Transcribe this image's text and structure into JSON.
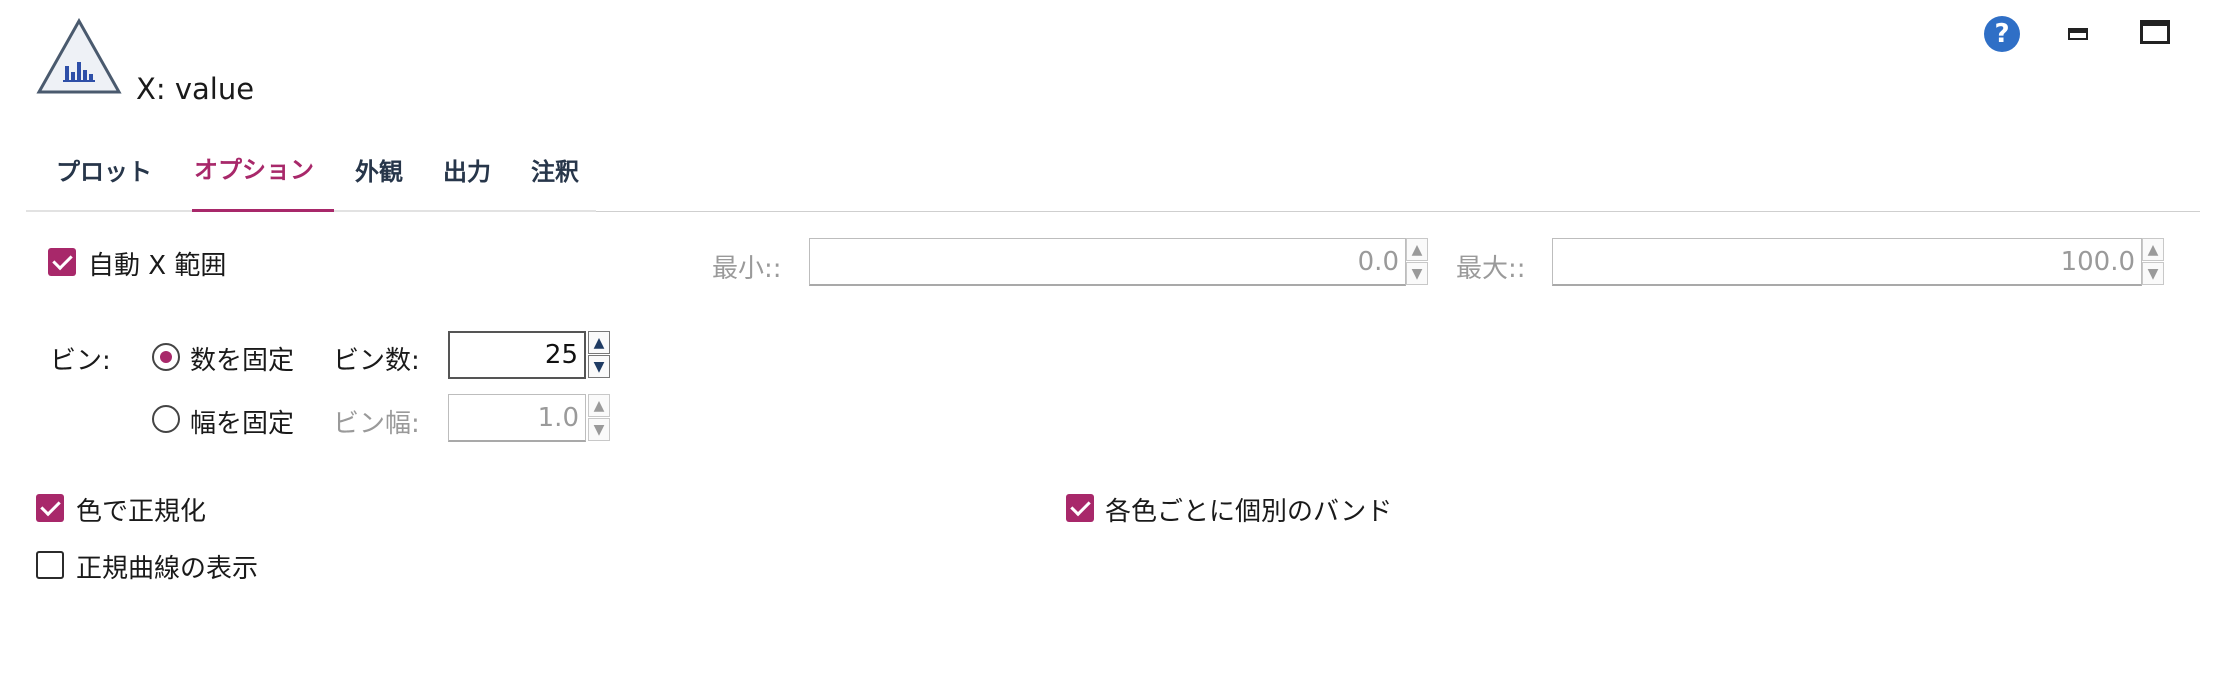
{
  "header": {
    "title": "X: value",
    "help_glyph": "?",
    "accent_color": "#a8286a"
  },
  "tabs": [
    {
      "label": "プロット",
      "active": false
    },
    {
      "label": "オプション",
      "active": true
    },
    {
      "label": "外観",
      "active": false
    },
    {
      "label": "出力",
      "active": false
    },
    {
      "label": "注釈",
      "active": false
    }
  ],
  "range": {
    "auto_label": "自動 X 範囲",
    "auto_checked": true,
    "min_label": "最小::",
    "min_value": "0.0",
    "max_label": "最大::",
    "max_value": "100.0"
  },
  "bins": {
    "label": "ビン:",
    "fixed_count_label": "数を固定",
    "fixed_count_selected": true,
    "count_label": "ビン数:",
    "count_value": "25",
    "fixed_width_label": "幅を固定",
    "fixed_width_selected": false,
    "width_label": "ビン幅:",
    "width_value": "1.0"
  },
  "options": {
    "normalize_color_label": "色で正規化",
    "normalize_color_checked": true,
    "separate_bands_label": "各色ごとに個別のバンド",
    "separate_bands_checked": true,
    "normal_curve_label": "正規曲線の表示",
    "normal_curve_checked": false
  },
  "icons": {
    "logo": "histogram-triangle-icon",
    "help": "help-icon",
    "minimize": "minimize-icon",
    "maximize": "maximize-icon"
  }
}
